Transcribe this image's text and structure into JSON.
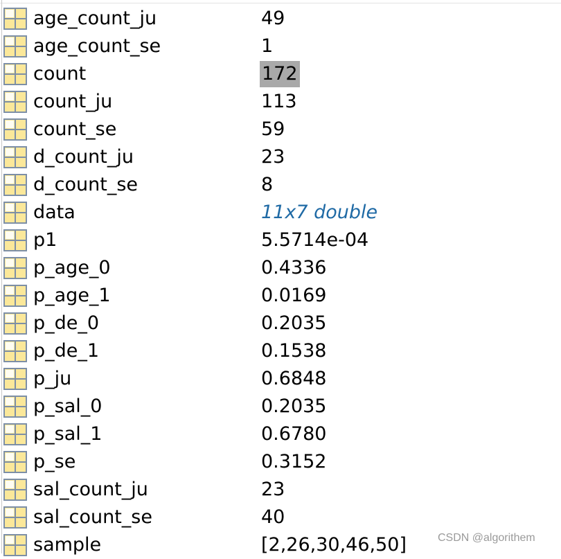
{
  "workspace": {
    "variables": [
      {
        "name": "age_count_ju",
        "value": "49"
      },
      {
        "name": "age_count_se",
        "value": "1"
      },
      {
        "name": "count",
        "value": "172",
        "selected": true
      },
      {
        "name": "count_ju",
        "value": "113"
      },
      {
        "name": "count_se",
        "value": "59"
      },
      {
        "name": "d_count_ju",
        "value": "23"
      },
      {
        "name": "d_count_se",
        "value": "8"
      },
      {
        "name": "data",
        "value": "11x7 double",
        "object": true
      },
      {
        "name": "p1",
        "value": "5.5714e-04"
      },
      {
        "name": "p_age_0",
        "value": "0.4336"
      },
      {
        "name": "p_age_1",
        "value": "0.0169"
      },
      {
        "name": "p_de_0",
        "value": "0.2035"
      },
      {
        "name": "p_de_1",
        "value": "0.1538"
      },
      {
        "name": "p_ju",
        "value": "0.6848"
      },
      {
        "name": "p_sal_0",
        "value": "0.2035"
      },
      {
        "name": "p_sal_1",
        "value": "0.6780"
      },
      {
        "name": "p_se",
        "value": "0.3152"
      },
      {
        "name": "sal_count_ju",
        "value": "23"
      },
      {
        "name": "sal_count_se",
        "value": "40"
      },
      {
        "name": "sample",
        "value": "[2,26,30,46,50]"
      }
    ],
    "icon": "matrix-variable-icon",
    "selection_color": "#a9a9a9",
    "object_value_color": "#1f6aa5"
  },
  "watermark": "CSDN @algorithem"
}
